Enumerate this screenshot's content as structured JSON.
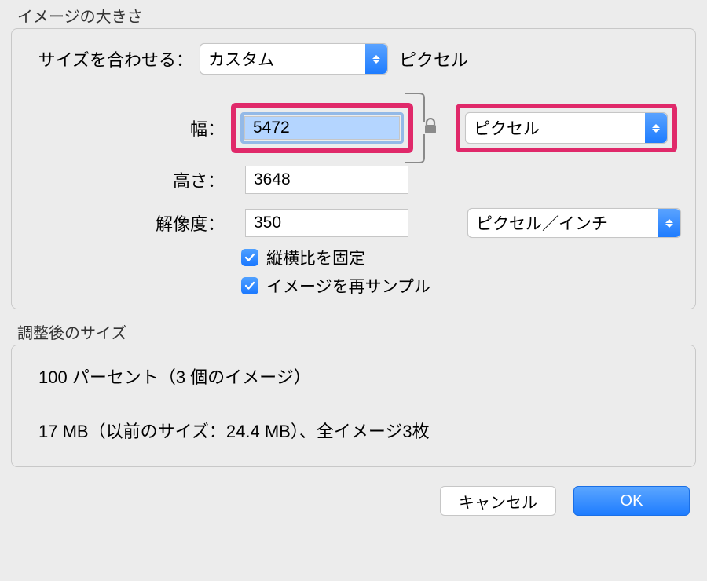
{
  "imageSize": {
    "groupLabel": "イメージの大きさ",
    "fitLabel": "サイズを合わせる：",
    "fitSelect": "カスタム",
    "fitUnit": "ピクセル",
    "widthLabel": "幅：",
    "widthValue": "5472",
    "heightLabel": "高さ：",
    "heightValue": "3648",
    "dimensionUnitSelect": "ピクセル",
    "resolutionLabel": "解像度：",
    "resolutionValue": "350",
    "resolutionUnitSelect": "ピクセル／インチ",
    "lockAspectLabel": "縦横比を固定",
    "resampleLabel": "イメージを再サンプル"
  },
  "adjusted": {
    "groupLabel": "調整後のサイズ",
    "line1": "100 パーセント（3 個のイメージ）",
    "line2": "17 MB（以前のサイズ：24.4 MB）、全イメージ3枚"
  },
  "buttons": {
    "cancel": "キャンセル",
    "ok": "OK"
  }
}
